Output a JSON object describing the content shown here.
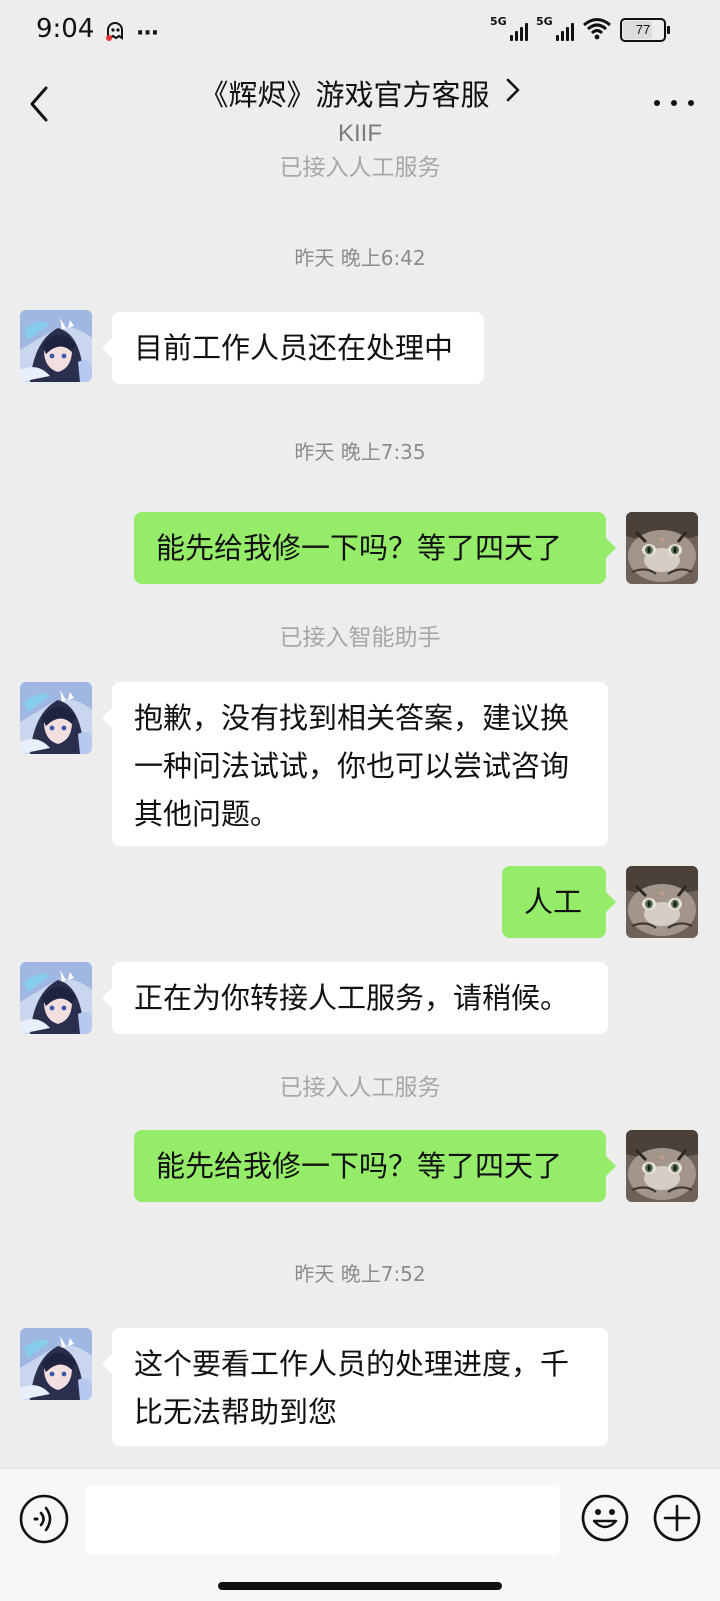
{
  "status_bar": {
    "time": "9:04",
    "more": "···",
    "signal1_label": "5G",
    "signal2_label": "5G",
    "battery": "77",
    "battery_level_percent": 77
  },
  "header": {
    "title": "《辉烬》游戏官方客服",
    "subtitle": "KIIF"
  },
  "chat": {
    "sys_1": "已接入人工服务",
    "time_1": "昨天 晚上6:42",
    "msg_1": "目前工作人员还在处理中",
    "time_2": "昨天 晚上7:35",
    "msg_2": "能先给我修一下吗？等了四天了",
    "sys_2": "已接入智能助手",
    "msg_3": "抱歉，没有找到相关答案，建议换一种问法试试，你也可以尝试咨询其他问题。",
    "msg_4": "人工",
    "msg_5": "正在为你转接人工服务，请稍候。",
    "sys_3": "已接入人工服务",
    "msg_6": "能先给我修一下吗？等了四天了",
    "time_3": "昨天 晚上7:52",
    "msg_7": "这个要看工作人员的处理进度，千比无法帮助到您"
  },
  "input": {
    "value": "",
    "placeholder": ""
  },
  "icons": {
    "back": "back-arrow-icon",
    "more": "more-dots-icon",
    "voice": "voice-icon",
    "emoji": "emoji-icon",
    "plus": "plus-icon"
  },
  "colors": {
    "background": "#ededed",
    "incoming_bubble": "#ffffff",
    "outgoing_bubble": "#95ec69"
  }
}
